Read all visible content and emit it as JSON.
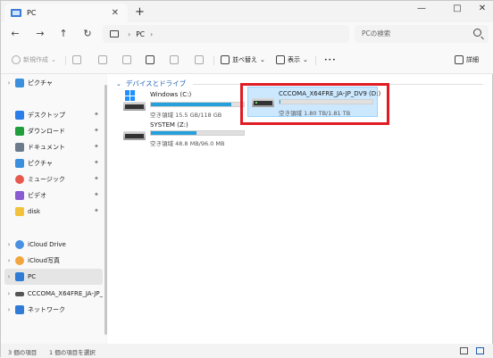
{
  "window": {
    "tab_title": "PC",
    "controls": {
      "minimize": "—",
      "maximize": "□",
      "close": "✕"
    }
  },
  "nav": {
    "breadcrumb": [
      "PC"
    ],
    "search_placeholder": "PCの検索"
  },
  "toolbar": {
    "new_label": "新規作成",
    "sort_label": "並べ替え",
    "view_label": "表示",
    "more_label": "•••",
    "details_label": "詳細"
  },
  "sidebar": {
    "top_item": "ピクチャ",
    "quick": [
      {
        "label": "デスクトップ",
        "icon": "desktop-icon",
        "color": "#2b7de9"
      },
      {
        "label": "ダウンロード",
        "icon": "download-icon",
        "color": "#1f9e3b"
      },
      {
        "label": "ドキュメント",
        "icon": "document-icon",
        "color": "#6b7b8c"
      },
      {
        "label": "ピクチャ",
        "icon": "picture-icon",
        "color": "#3c8fdc"
      },
      {
        "label": "ミュージック",
        "icon": "music-icon",
        "color": "#e8594d"
      },
      {
        "label": "ビデオ",
        "icon": "video-icon",
        "color": "#8a5cd1"
      },
      {
        "label": "disk",
        "icon": "folder-icon",
        "color": "#f3c23c"
      }
    ],
    "cloud": [
      {
        "label": "iCloud Drive",
        "icon": "icloud-drive-icon",
        "color": "#4a90e2"
      },
      {
        "label": "iCloud写真",
        "icon": "icloud-photos-icon",
        "color": "#f2a53c"
      }
    ],
    "pc": {
      "label": "PC",
      "icon": "pc-icon",
      "color": "#2f7bd6"
    },
    "drive": {
      "label": "CCCOMA_X64FRE_JA-JP_DV",
      "icon": "drive-icon",
      "color": "#555555"
    },
    "network": {
      "label": "ネットワーク",
      "icon": "network-icon",
      "color": "#2f7bd6"
    }
  },
  "content": {
    "group_header": "デバイスとドライブ",
    "drives": [
      {
        "name": "Windows (C:)",
        "free_text": "空き領域 15.5 GB/118 GB",
        "used_fraction": 0.87
      },
      {
        "name": "CCCOMA_X64FRE_JA-JP_DV9 (D:)",
        "free_text": "空き領域 1.80 TB/1.81 TB",
        "used_fraction": 0.01
      },
      {
        "name": "SYSTEM (Z:)",
        "free_text": "空き領域 48.8 MB/96.0 MB",
        "used_fraction": 0.49
      }
    ]
  },
  "status": {
    "count": "3 個の項目",
    "selected": "1 個の項目を選択"
  }
}
